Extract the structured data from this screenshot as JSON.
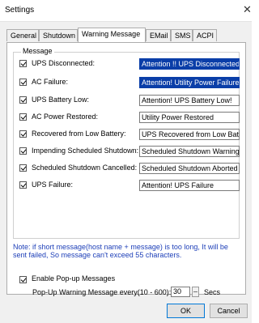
{
  "window": {
    "title": "Settings",
    "close_glyph": "✕"
  },
  "tabs": [
    {
      "label": "General"
    },
    {
      "label": "Shutdown"
    },
    {
      "label": "Warning Message",
      "active": true
    },
    {
      "label": "EMail"
    },
    {
      "label": "SMS"
    },
    {
      "label": "ACPI"
    }
  ],
  "message_group": {
    "label": "Message",
    "items": [
      {
        "label": "UPS Disconnected:",
        "checked": true,
        "value": "Attention !! UPS Disconnected",
        "selected": true
      },
      {
        "label": "AC Failure:",
        "checked": true,
        "value": "Attention! Utility Power Failure",
        "selected": true
      },
      {
        "label": "UPS Battery Low:",
        "checked": true,
        "value": "Attention! UPS Battery Low!"
      },
      {
        "label": "AC Power Restored:",
        "checked": true,
        "value": "Utility Power Restored"
      },
      {
        "label": "Recovered from Low Battery:",
        "checked": true,
        "value": "UPS Recovered from Low Battery"
      },
      {
        "label": "Impending Scheduled Shutdown:",
        "checked": true,
        "value": "Scheduled Shutdown Warning"
      },
      {
        "label": "Scheduled Shutdown Cancelled:",
        "checked": true,
        "value": "Scheduled Shutdown Aborted"
      },
      {
        "label": "UPS Failure:",
        "checked": true,
        "value": "Attention! UPS Failure"
      }
    ]
  },
  "note": "Note: if short message(host name + message) is too long, It will be sent failed, So message can't exceed 55 characters.",
  "popup": {
    "enable_label": "Enable Pop-up Messages",
    "enabled": true,
    "interval_label": "Pop-Up Warning Message every(10 - 600):",
    "interval_value": "30",
    "unit": "Secs"
  },
  "buttons": {
    "ok": "OK",
    "cancel": "Cancel"
  }
}
